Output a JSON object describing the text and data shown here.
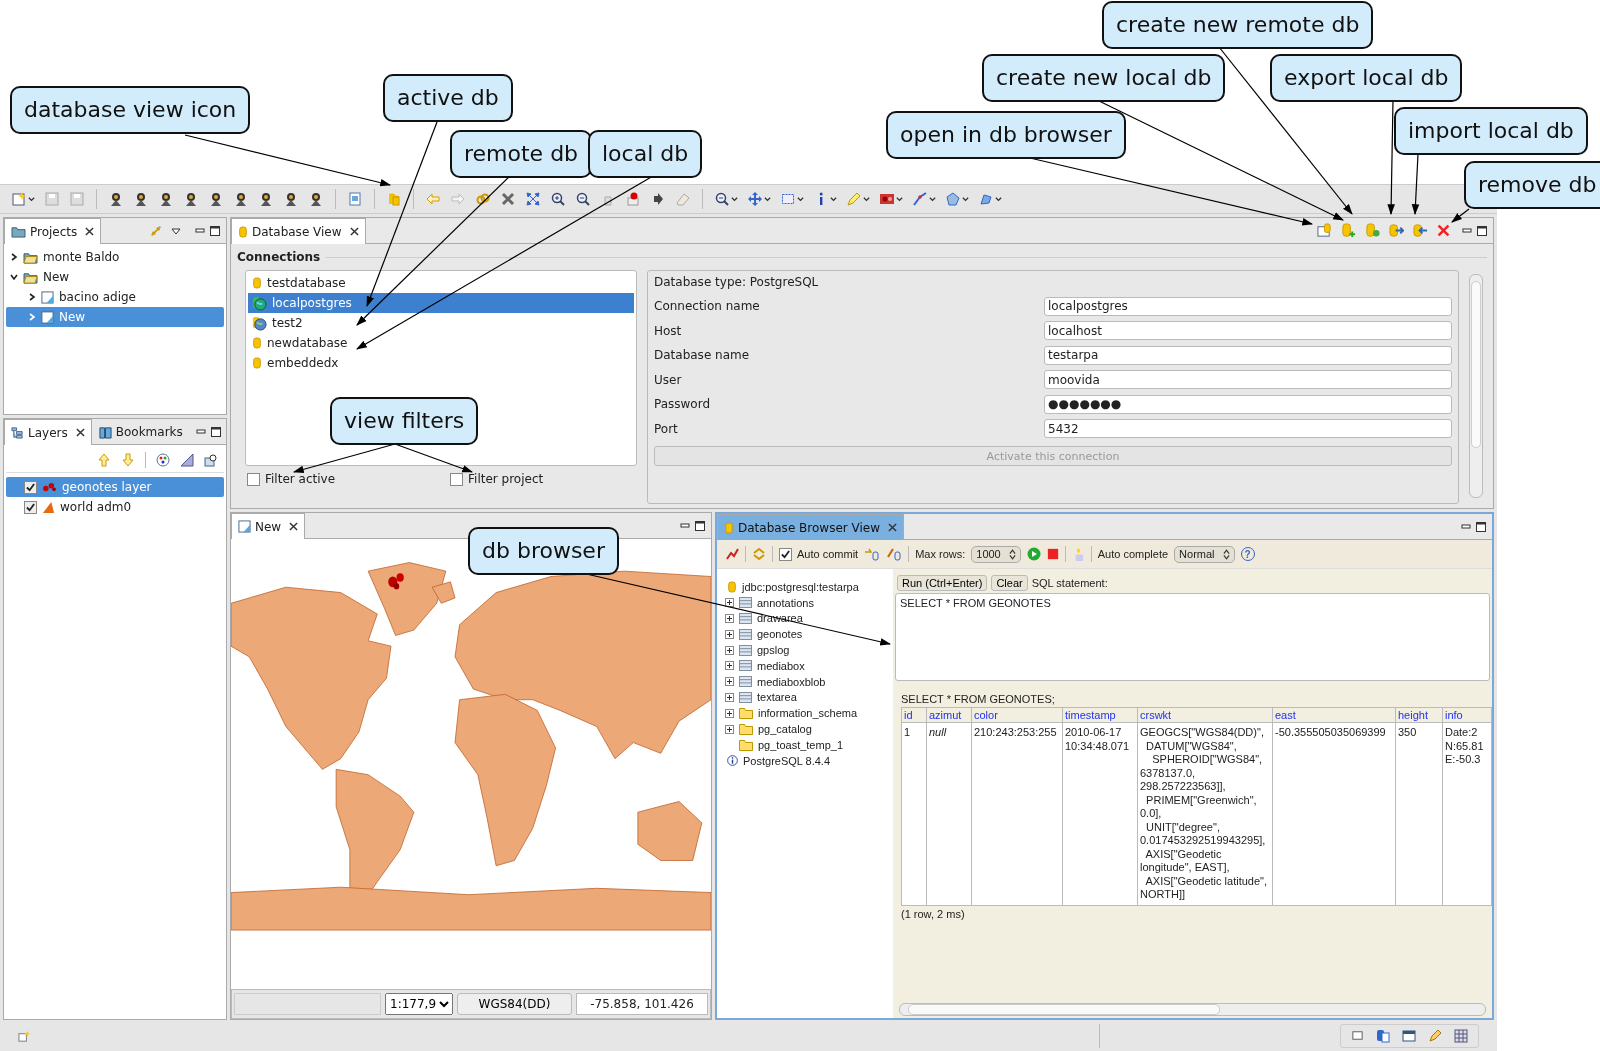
{
  "callouts": [
    {
      "text": "create new remote db"
    },
    {
      "text": "create new local db"
    },
    {
      "text": "export local db"
    },
    {
      "text": "database view icon"
    },
    {
      "text": "active db"
    },
    {
      "text": "open in db browser"
    },
    {
      "text": "import local db"
    },
    {
      "text": "remote db"
    },
    {
      "text": "local db"
    },
    {
      "text": "remove db"
    },
    {
      "text": "view filters"
    },
    {
      "text": "db browser"
    }
  ],
  "projects_panel": {
    "tab": "Projects",
    "tree": [
      {
        "label": "monte Baldo",
        "kind": "project",
        "expanded": false,
        "selected": false
      },
      {
        "label": "New",
        "kind": "project",
        "expanded": true,
        "selected": false,
        "children": [
          {
            "label": "bacino adige",
            "kind": "map",
            "expanded": false,
            "selected": false
          },
          {
            "label": "New",
            "kind": "map",
            "expanded": false,
            "selected": true
          }
        ]
      }
    ]
  },
  "layers_panel": {
    "tabs": [
      {
        "label": "Layers",
        "selected": true
      },
      {
        "label": "Bookmarks",
        "selected": false
      }
    ],
    "layers": [
      {
        "label": "geonotes layer",
        "kind": "points",
        "checked": true,
        "selected": true
      },
      {
        "label": "world adm0",
        "kind": "polygon",
        "checked": true,
        "selected": false
      }
    ]
  },
  "database_view": {
    "tab": "Database View",
    "connections_label": "Connections",
    "connections": [
      {
        "name": "testdatabase",
        "kind": "local",
        "selected": false
      },
      {
        "name": "localpostgres",
        "kind": "active",
        "selected": true
      },
      {
        "name": "test2",
        "kind": "remote",
        "selected": false
      },
      {
        "name": "newdatabase",
        "kind": "local",
        "selected": false
      },
      {
        "name": "embeddedx",
        "kind": "local",
        "selected": false
      }
    ],
    "filters": [
      {
        "label": "Filter active",
        "checked": false
      },
      {
        "label": "Filter project",
        "checked": false
      }
    ],
    "database_type": "Database type: PostgreSQL",
    "fields": [
      {
        "label": "Connection name",
        "value": "localpostgres"
      },
      {
        "label": "Host",
        "value": "localhost"
      },
      {
        "label": "Database name",
        "value": "testarpa"
      },
      {
        "label": "User",
        "value": "moovida"
      },
      {
        "label": "Password",
        "value": "●●●●●●●"
      },
      {
        "label": "Port",
        "value": "5432"
      }
    ],
    "activate_button": {
      "label": "Activate this connection",
      "disabled": true
    }
  },
  "map_view": {
    "tab": "New",
    "scale": "1:177,9",
    "crs": "WGS84(DD)",
    "coordinates": "-75.858, 101.426"
  },
  "db_browser": {
    "tab": "Database Browser View",
    "auto_commit": {
      "label": "Auto commit",
      "checked": true
    },
    "max_rows_label": "Max rows:",
    "max_rows": "1000",
    "auto_complete_label": "Auto complete",
    "auto_complete": "Normal",
    "help": "?",
    "connection": "jdbc:postgresql:testarpa",
    "tree": [
      {
        "label": "annotations",
        "kind": "table",
        "expandable": true
      },
      {
        "label": "drawarea",
        "kind": "table",
        "expandable": true
      },
      {
        "label": "geonotes",
        "kind": "table",
        "expandable": true
      },
      {
        "label": "gpslog",
        "kind": "table",
        "expandable": true
      },
      {
        "label": "mediabox",
        "kind": "table",
        "expandable": true
      },
      {
        "label": "mediaboxblob",
        "kind": "table",
        "expandable": true
      },
      {
        "label": "textarea",
        "kind": "table",
        "expandable": true
      },
      {
        "label": "information_schema",
        "kind": "folder",
        "expandable": true
      },
      {
        "label": "pg_catalog",
        "kind": "folder",
        "expandable": true
      },
      {
        "label": "pg_toast_temp_1",
        "kind": "folder",
        "expandable": false
      }
    ],
    "server": "PostgreSQL 8.4.4",
    "run_button": "Run (Ctrl+Enter)",
    "clear_button": "Clear",
    "sql_label": "SQL statement:",
    "sql": "SELECT * FROM GEONOTES",
    "result_title": "SELECT * FROM GEONOTES;",
    "columns": [
      "id",
      "azimut",
      "color",
      "timestamp",
      "crswkt",
      "east",
      "height",
      "info"
    ],
    "rows": [
      {
        "cells": [
          {
            "text": "1"
          },
          {
            "text": "null",
            "kind": "null"
          },
          {
            "text": "210:243:253:255"
          },
          {
            "text": "2010-06-17\n10:34:48.071"
          },
          {
            "text": "GEOGCS[\"WGS84(DD)\",\n  DATUM[\"WGS84\",\n    SPHEROID[\"WGS84\",\n6378137.0,\n298.257223563]],\n  PRIMEM[\"Greenwich\",\n0.0],\n  UNIT[\"degree\",\n0.017453292519943295],\n  AXIS[\"Geodetic\nlongitude\", EAST],\n  AXIS[\"Geodetic latitude\",\nNORTH]]"
          },
          {
            "text": "-50.355505035069399"
          },
          {
            "text": "350"
          },
          {
            "text": "Date:2\nN:65.81\nE:-50.3"
          }
        ]
      }
    ],
    "summary": "(1 row, 2 ms)"
  }
}
